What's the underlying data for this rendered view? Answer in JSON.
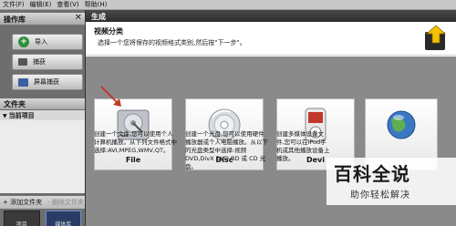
{
  "menu": [
    "文件(F)",
    "编辑(E)",
    "查看(V)",
    "帮助(H)"
  ],
  "left_panel": {
    "title": "操作库",
    "close": "✕",
    "buttons": [
      {
        "label": "导入",
        "icon": "plus-icon"
      },
      {
        "label": "捕获",
        "icon": "camera-icon"
      },
      {
        "label": "屏幕捕获",
        "icon": "monitor-icon"
      }
    ],
    "folder_title": "文件夹",
    "folder_item": "当前项目",
    "bottom": {
      "add": "+ 添加文件夹",
      "remove": "- 删除文件夹"
    },
    "thumbs": [
      "项目",
      "媒体库"
    ]
  },
  "dialog": {
    "title": "生成",
    "heading": "视频分类",
    "subheading": "选择一个您将保存的视频格式类别,然后按\"下一步\"。",
    "cards": [
      {
        "label": "File",
        "icon": "hard-drive-icon"
      },
      {
        "label": "Disc",
        "icon": "disc-icon"
      },
      {
        "label": "Devi",
        "icon": "media-player-icon"
      },
      {
        "label": "",
        "icon": "globe-icon"
      }
    ],
    "descriptions": [
      "创建一个文件,您可以使用个人计算机播放。从下列文件格式中选择:AVI,MPEG,WMV,QT。",
      "创建一个光盘,您可以使用硬件播放器或个人电脑播放。从以下的光盘类型中选择:视频 DVD,DivX DVD,BD 或 CD 光盘。",
      "创建多媒体设备文件,您可以在iPod手机或其他播放设备上播放。",
      ""
    ]
  },
  "watermark": {
    "big": "百科全说",
    "small": "助你轻松解决"
  },
  "colors": {
    "dialog_title_bg": "#2c2c2c",
    "arrow": "#c0392b",
    "watermark_green": "#2e9e3e"
  }
}
